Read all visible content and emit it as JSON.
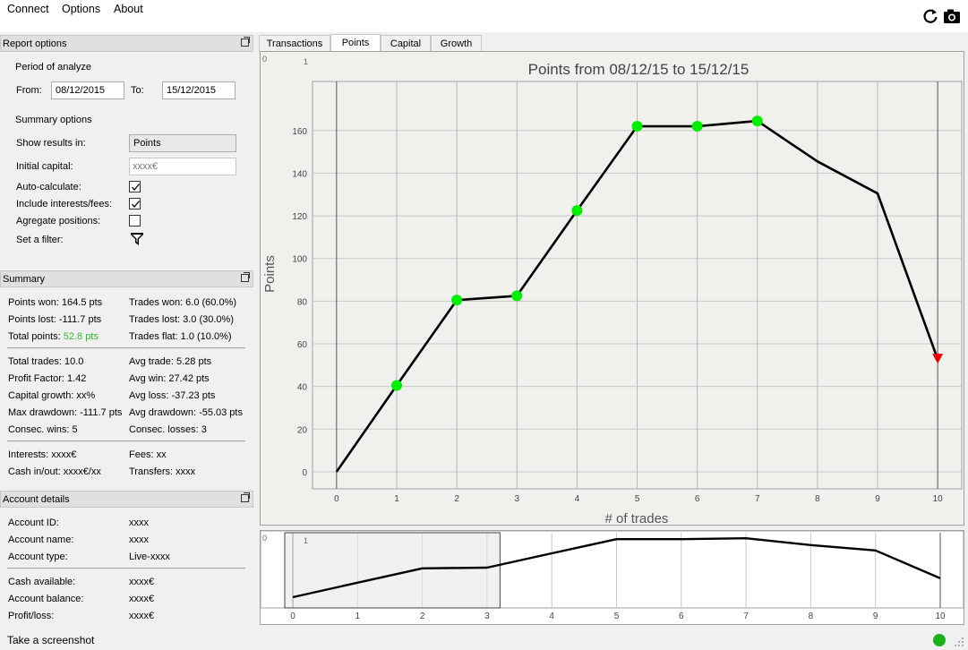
{
  "menu": {
    "connect": "Connect",
    "options": "Options",
    "about": "About"
  },
  "icons": {
    "refresh": "refresh-icon",
    "camera": "camera-icon"
  },
  "report_options": {
    "title": "Report options",
    "period_title": "Period of analyze",
    "from_label": "From:",
    "from_value": "08/12/2015",
    "to_label": "To:",
    "to_value": "15/12/2015",
    "summary_title": "Summary options",
    "show_results_label": "Show results in:",
    "show_results_value": "Points",
    "initial_capital_label": "Initial capital:",
    "initial_capital_placeholder": "xxxx€",
    "auto_calculate_label": "Auto-calculate:",
    "auto_calculate": true,
    "include_fees_label": "Include interests/fees:",
    "include_fees": true,
    "aggregate_label": "Agregate positions:",
    "aggregate": false,
    "filter_label": "Set a filter:"
  },
  "summary": {
    "title": "Summary",
    "points_won": "Points won: 164.5 pts",
    "trades_won": "Trades won: 6.0 (60.0%)",
    "points_lost": "Points lost: -111.7 pts",
    "trades_lost": "Trades lost: 3.0 (30.0%)",
    "total_points_label": "Total points:",
    "total_points_value": "52.8 pts",
    "trades_flat": "Trades flat: 1.0 (10.0%)",
    "total_trades": "Total trades: 10.0",
    "avg_trade": "Avg trade: 5.28 pts",
    "profit_factor": "Profit Factor: 1.42",
    "avg_win": "Avg win: 27.42 pts",
    "capital_growth": "Capital growth: xx%",
    "avg_loss": "Avg loss: -37.23 pts",
    "max_drawdown": "Max drawdown: -111.7 pts",
    "avg_drawdown": "Avg drawdown: -55.03 pts",
    "consec_wins": "Consec. wins: 5",
    "consec_losses": "Consec. losses: 3",
    "interests": "Interests: xxxx€",
    "fees": "Fees: xx",
    "cash_inout": "Cash in/out: xxxx€/xx",
    "transfers": "Transfers: xxxx",
    "green": "#2ebd2e"
  },
  "account": {
    "title": "Account details",
    "id_label": "Account ID:",
    "id_value": "xxxx",
    "name_label": "Account name:",
    "name_value": "xxxx",
    "type_label": "Account type:",
    "type_value": "Live-xxxx",
    "cash_label": "Cash available:",
    "cash_value": "xxxx€",
    "balance_label": "Account balance:",
    "balance_value": "xxxx€",
    "pl_label": "Profit/loss:",
    "pl_value": "xxxx€"
  },
  "tabs": [
    "Transactions",
    "Points",
    "Capital",
    "Growth"
  ],
  "active_tab": "Points",
  "status": {
    "screenshot_label": "Take a screenshot",
    "indicator_color": "#1ab01a"
  },
  "chart_data": {
    "type": "line",
    "title": "Points from 08/12/15 to 15/12/15",
    "xlabel": "# of trades",
    "ylabel": "Points",
    "x": [
      0,
      1,
      2,
      3,
      4,
      5,
      6,
      7,
      8,
      9,
      10
    ],
    "y": [
      0,
      40.5,
      80.5,
      82.5,
      122.5,
      162,
      162,
      164.5,
      145.5,
      130.5,
      52.8
    ],
    "markers": [
      "none",
      "win",
      "win",
      "win",
      "win",
      "win",
      "win",
      "win",
      "none",
      "none",
      "loss"
    ],
    "xlim": [
      -0.4,
      10.4
    ],
    "ylim": [
      -8,
      183
    ],
    "yticks": [
      0,
      20,
      40,
      60,
      80,
      100,
      120,
      140,
      160
    ],
    "xticks": [
      0,
      1,
      2,
      3,
      4,
      5,
      6,
      7,
      8,
      9,
      10
    ],
    "corner_labels": [
      "0",
      "1"
    ],
    "win_color": "#00ee00",
    "loss_color": "#ee0000",
    "line_color": "#000000",
    "grid": true,
    "navigator": {
      "xticks": [
        0,
        1,
        2,
        3,
        4,
        5,
        6,
        7,
        8,
        9,
        10
      ],
      "selection": [
        0,
        3.2
      ]
    }
  }
}
